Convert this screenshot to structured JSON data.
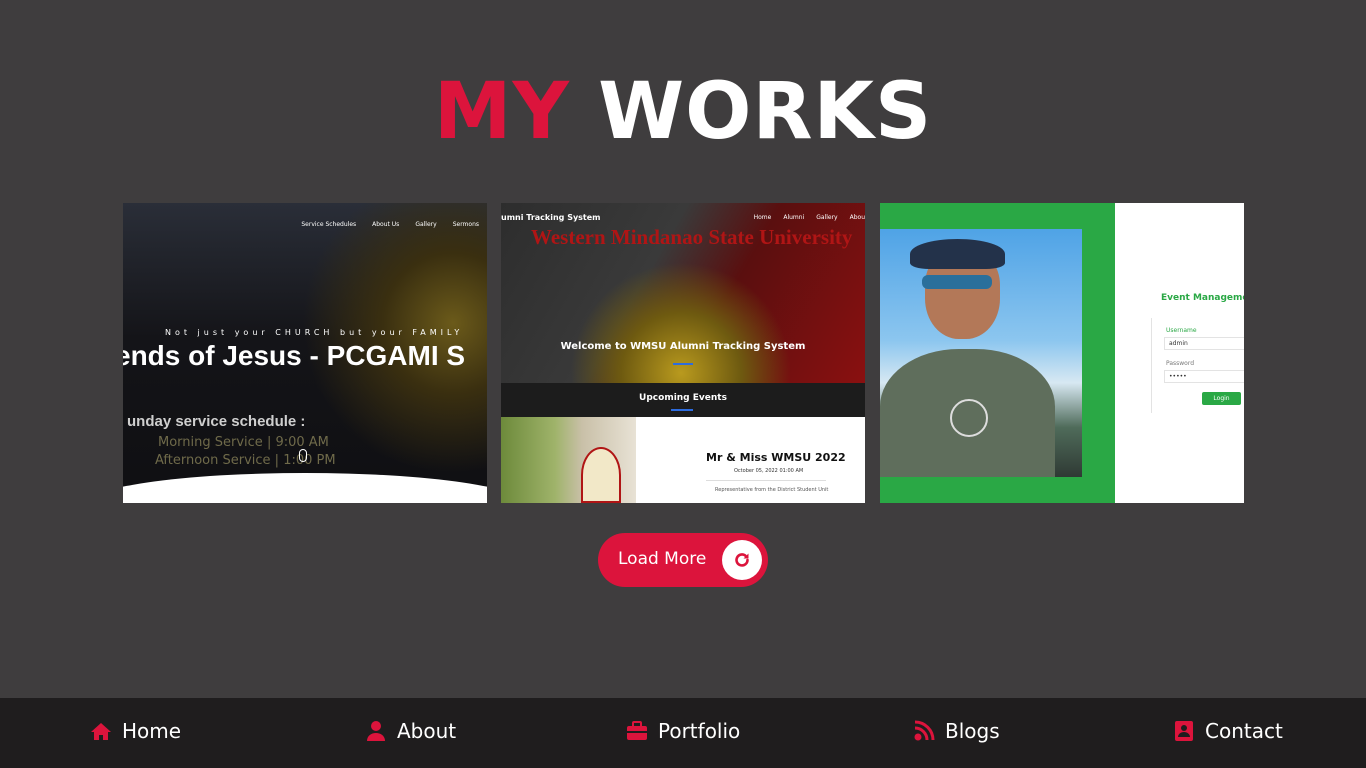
{
  "title": {
    "part1": "MY",
    "part2": "WORKS"
  },
  "projects": [
    {
      "nav": [
        "Service Schedules",
        "About Us",
        "Gallery",
        "Sermons"
      ],
      "tagline": "Not just your CHURCH but your FAMILY",
      "headline": "ends of Jesus - PCGAMI S",
      "schedule_heading": "unday service schedule :",
      "schedule_line1": "Morning Service  | 9:00 AM",
      "schedule_line2": "Afternoon Service  | 1:00 PM"
    },
    {
      "brand": "umni Tracking System",
      "nav": [
        "Home",
        "Alumni",
        "Gallery",
        "Abou"
      ],
      "university": "Western Mindanao State University",
      "welcome": "Welcome to WMSU Alumni Tracking System",
      "events_title": "Upcoming Events",
      "event_name": "Mr & Miss WMSU 2022",
      "event_date": "October 05, 2022 01:00 AM",
      "event_desc": "Representative from the District Student Unit"
    },
    {
      "login_title": "Event Managemen",
      "username_label": "Username",
      "username_value": "admin",
      "password_label": "Password",
      "password_value": "•••••",
      "login_button": "Login"
    }
  ],
  "load_more": {
    "label": "Load More",
    "icon": "refresh-icon"
  },
  "bottom_nav": [
    {
      "label": "Home",
      "icon": "home-icon"
    },
    {
      "label": "About",
      "icon": "user-icon"
    },
    {
      "label": "Portfolio",
      "icon": "briefcase-icon"
    },
    {
      "label": "Blogs",
      "icon": "blog-icon"
    },
    {
      "label": "Contact",
      "icon": "address-book-icon"
    }
  ],
  "colors": {
    "accent": "#dc143c",
    "background": "#3f3d3e",
    "nav_background": "#1f1d1e",
    "green": "#2aa845"
  }
}
